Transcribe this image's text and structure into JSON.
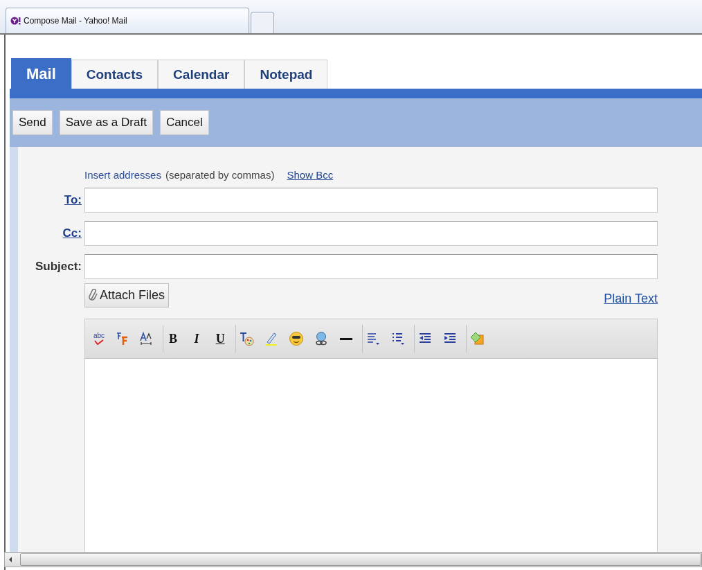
{
  "browser_tab": {
    "title": "Compose Mail - Yahoo! Mail"
  },
  "tabs": [
    {
      "label": "Mail",
      "selected": true
    },
    {
      "label": "Contacts",
      "selected": false
    },
    {
      "label": "Calendar",
      "selected": false
    },
    {
      "label": "Notepad",
      "selected": false
    }
  ],
  "actions": [
    "Send",
    "Save as a Draft",
    "Cancel"
  ],
  "hint": {
    "link": "Insert addresses",
    "text": "(separated by commas)",
    "show_bcc": "Show Bcc"
  },
  "fields": [
    {
      "label": "To:",
      "kind": "link"
    },
    {
      "label": "Cc:",
      "kind": "link"
    },
    {
      "label": "Subject:",
      "kind": "plain"
    }
  ],
  "attach": "Attach Files",
  "plain_text": "Plain Text",
  "toolbar": [
    [
      {
        "kind": "spell",
        "label": "abc"
      },
      {
        "kind": "font"
      },
      {
        "kind": "size"
      }
    ],
    [
      {
        "kind": "bold",
        "label": "B"
      },
      {
        "kind": "italic",
        "label": "I"
      },
      {
        "kind": "underline",
        "label": "U"
      }
    ],
    [
      {
        "kind": "color"
      },
      {
        "kind": "highlight"
      },
      {
        "kind": "emoticon"
      },
      {
        "kind": "link"
      },
      {
        "kind": "rule"
      }
    ],
    [
      {
        "kind": "align"
      },
      {
        "kind": "bullets"
      }
    ],
    [
      {
        "kind": "outdent"
      },
      {
        "kind": "indent"
      }
    ],
    [
      {
        "kind": "stationery"
      }
    ]
  ]
}
